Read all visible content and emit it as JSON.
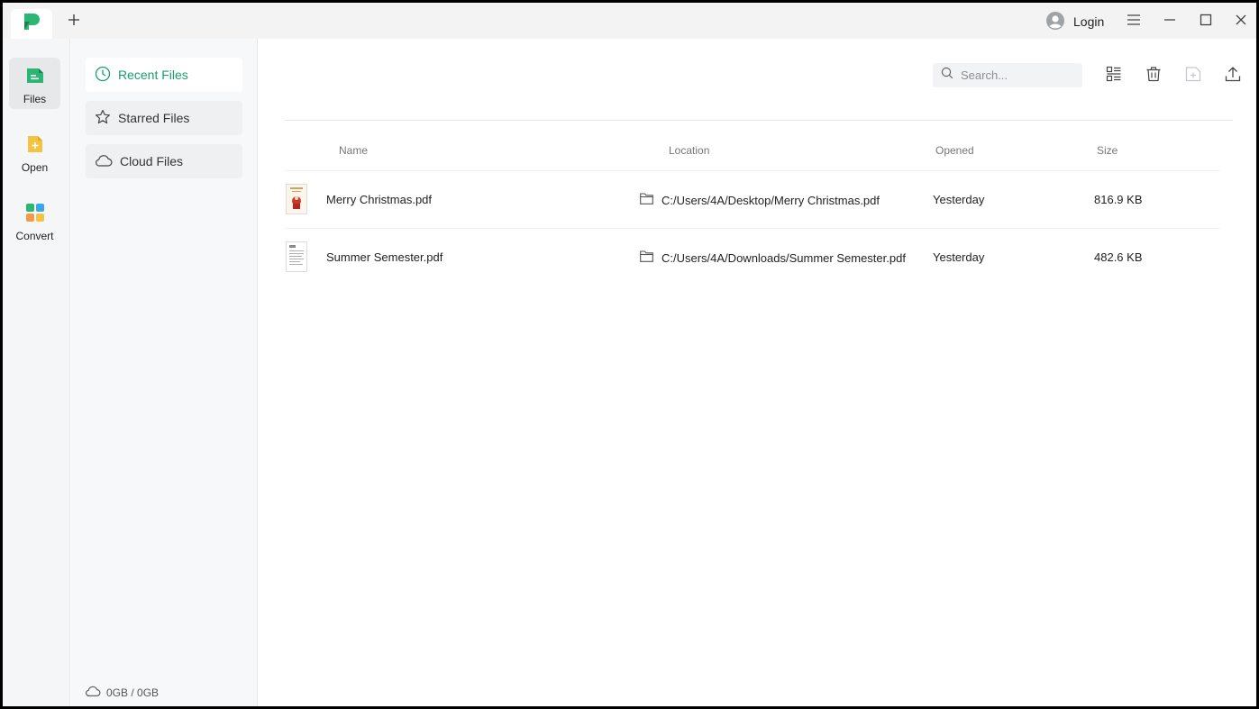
{
  "titlebar": {
    "new_tab_icon": "plus-icon",
    "login_label": "Login",
    "icons": [
      "app-logo-icon",
      "user-avatar-icon",
      "menu-icon",
      "minimize-icon",
      "maximize-icon",
      "close-icon"
    ]
  },
  "rail": {
    "items": [
      {
        "label": "Files",
        "icon": "files-icon",
        "active": true
      },
      {
        "label": "Open",
        "icon": "open-file-icon",
        "active": false
      },
      {
        "label": "Convert",
        "icon": "convert-icon",
        "active": false
      }
    ]
  },
  "subnav": {
    "items": [
      {
        "label": "Recent Files",
        "icon": "clock-icon",
        "active": true
      },
      {
        "label": "Starred Files",
        "icon": "star-icon",
        "active": false
      },
      {
        "label": "Cloud Files",
        "icon": "cloud-icon",
        "active": false
      }
    ],
    "storage": "0GB / 0GB"
  },
  "toolbar": {
    "search_placeholder": "Search...",
    "tools": [
      "list-view-icon",
      "delete-icon",
      "new-folder-icon",
      "upload-icon"
    ]
  },
  "table": {
    "headers": {
      "name": "Name",
      "location": "Location",
      "opened": "Opened",
      "size": "Size"
    },
    "rows": [
      {
        "name": "Merry Christmas.pdf",
        "location": "C:/Users/4A/Desktop/Merry Christmas.pdf",
        "opened": "Yesterday",
        "size": "816.9 KB"
      },
      {
        "name": "Summer Semester.pdf",
        "location": "C:/Users/4A/Downloads/Summer Semester.pdf",
        "opened": "Yesterday",
        "size": "482.6 KB"
      }
    ]
  },
  "colors": {
    "accent": "#1a9c6c",
    "brand_green": "#2bb673",
    "open_yellow": "#f5c342"
  }
}
